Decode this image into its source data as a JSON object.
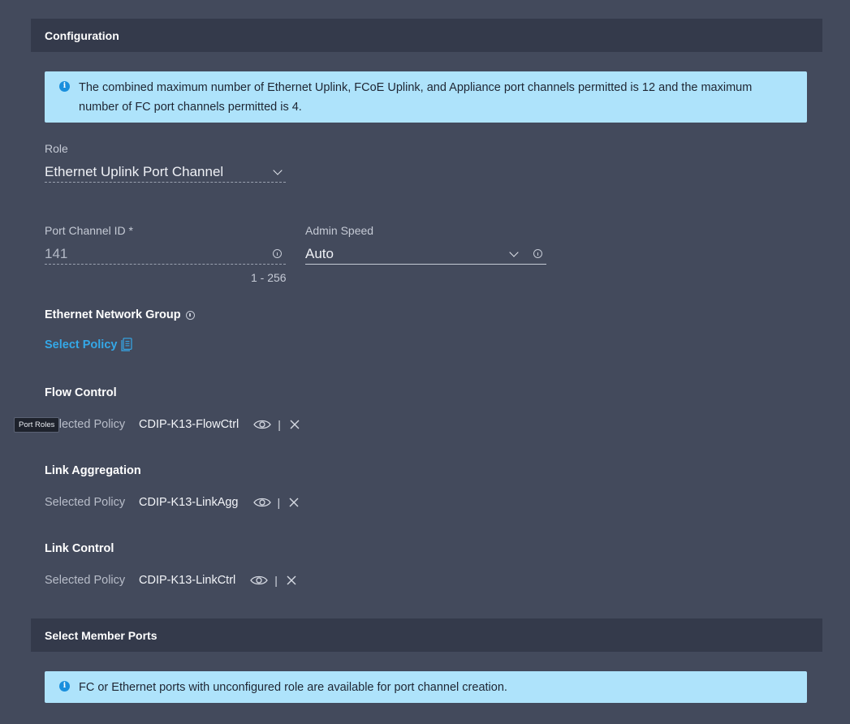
{
  "configuration": {
    "header": "Configuration",
    "info_text": "The combined maximum number of Ethernet Uplink, FCoE Uplink, and Appliance port channels permitted is 12 and the maximum number of FC port channels permitted is 4."
  },
  "role": {
    "label": "Role",
    "value": "Ethernet Uplink Port Channel"
  },
  "port_channel_id": {
    "label": "Port Channel ID *",
    "value": "141",
    "range_hint": "1 - 256"
  },
  "admin_speed": {
    "label": "Admin Speed",
    "value": "Auto"
  },
  "ethernet_network_group": {
    "title": "Ethernet Network Group",
    "select_policy_label": "Select Policy"
  },
  "flow_control": {
    "title": "Flow Control",
    "selected_label": "Selected Policy",
    "policy_name": "CDIP-K13-FlowCtrl"
  },
  "link_aggregation": {
    "title": "Link Aggregation",
    "selected_label": "Selected Policy",
    "policy_name": "CDIP-K13-LinkAgg"
  },
  "link_control": {
    "title": "Link Control",
    "selected_label": "Selected Policy",
    "policy_name": "CDIP-K13-LinkCtrl"
  },
  "separator": "|",
  "tooltip": {
    "text": "Port Roles"
  },
  "member_ports": {
    "header": "Select Member Ports",
    "info_text": "FC or Ethernet ports with unconfigured role are available for port channel creation."
  },
  "colors": {
    "background": "#434a5c",
    "section_header": "#343a4b",
    "info_box": "#aee3fb",
    "link_accent": "#34a8e8"
  }
}
